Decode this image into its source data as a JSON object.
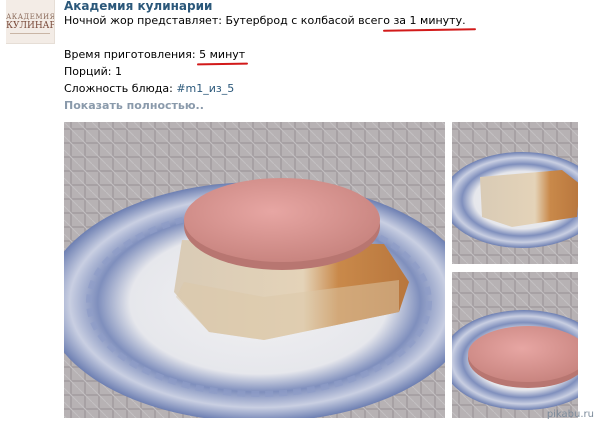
{
  "post": {
    "author": "Академия кулинарии",
    "intro_before_marked": "Ночной жор представляет: Бутерброд с колбасой всего ",
    "intro_marked": "за 1 минуту",
    "intro_after_marked": ".",
    "prep_label": "Время приготовления: ",
    "prep_value": "5 минут",
    "portions": "Порций: 1",
    "difficulty_label": "Сложность блюда: ",
    "difficulty_tag": "#m1_из_5",
    "show_more": "Показать полностью.."
  },
  "avatar": {
    "line1": "АКАДЕМИЯ",
    "line2": "КУЛИНАРИИ"
  },
  "watermark": "pikabu.ru",
  "colors": {
    "author_link": "#2b587a",
    "show_more": "#8a9aab",
    "annotation_red": "#d21a1a"
  }
}
